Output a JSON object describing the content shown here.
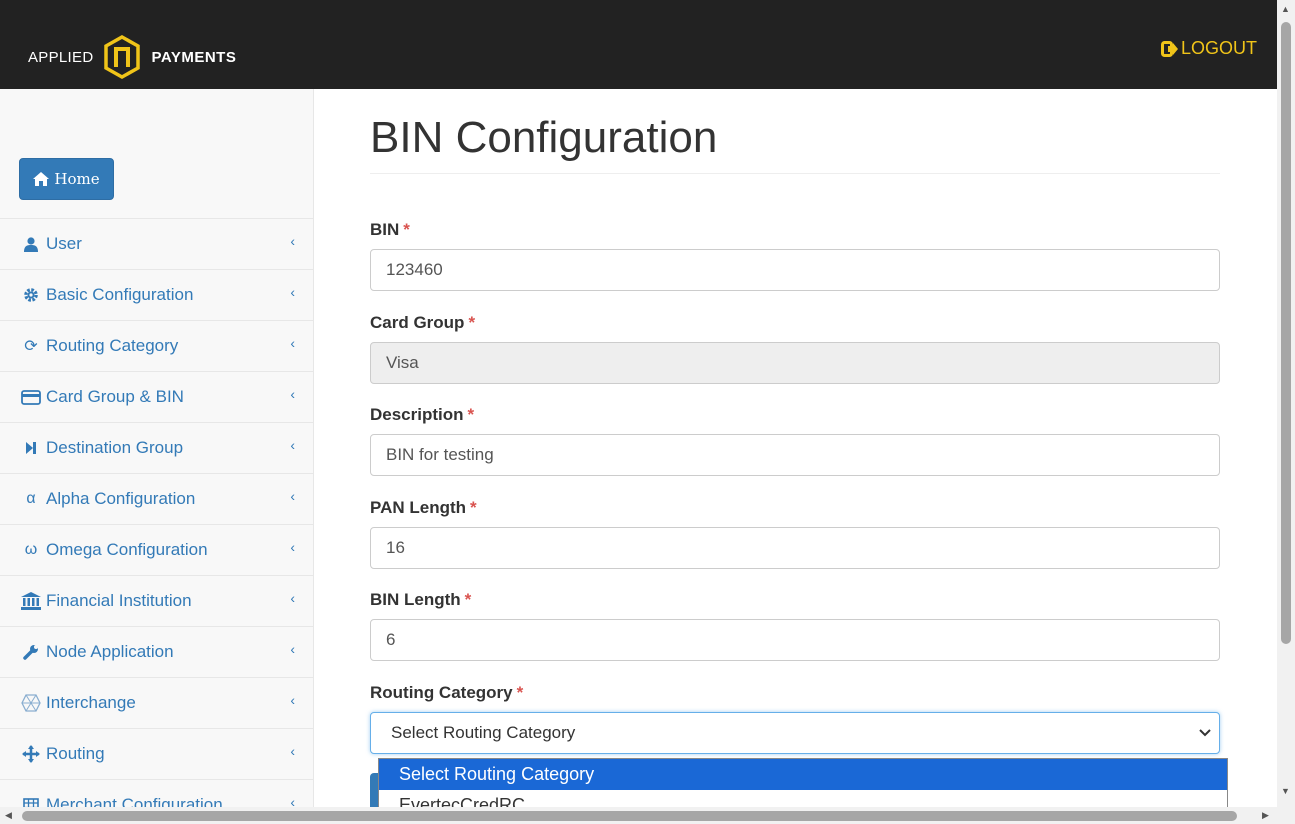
{
  "header": {
    "logo_left": "APPLIED",
    "logo_right": "PAYMENTS",
    "logout_label": "LOGOUT"
  },
  "sidebar": {
    "home_label": "Home",
    "items": [
      {
        "label": "User",
        "icon": "user-icon"
      },
      {
        "label": "Basic Configuration",
        "icon": "gear-icon"
      },
      {
        "label": "Routing Category",
        "icon": "refresh-icon"
      },
      {
        "label": "Card Group & BIN",
        "icon": "credit-card-icon"
      },
      {
        "label": "Destination Group",
        "icon": "step-forward-icon"
      },
      {
        "label": "Alpha Configuration",
        "icon": "alpha-icon"
      },
      {
        "label": "Omega Configuration",
        "icon": "omega-icon"
      },
      {
        "label": "Financial Institution",
        "icon": "bank-icon"
      },
      {
        "label": "Node Application",
        "icon": "wrench-icon"
      },
      {
        "label": "Interchange",
        "icon": "globe-icon"
      },
      {
        "label": "Routing",
        "icon": "arrows-icon"
      },
      {
        "label": "Merchant Configuration",
        "icon": "table-icon"
      }
    ]
  },
  "main": {
    "title": "BIN Configuration",
    "fields": {
      "bin": {
        "label": "BIN",
        "value": "123460"
      },
      "card_group": {
        "label": "Card Group",
        "value": "Visa"
      },
      "description": {
        "label": "Description",
        "value": "BIN for testing"
      },
      "pan_length": {
        "label": "PAN Length",
        "value": "16"
      },
      "bin_length": {
        "label": "BIN Length",
        "value": "6"
      },
      "routing_category": {
        "label": "Routing Category",
        "value": "Select Routing Category"
      }
    },
    "required_mark": "*",
    "dropdown_options": [
      "Select Routing Category",
      "EvertecCredRC"
    ]
  },
  "colors": {
    "header_bg": "#222222",
    "accent_yellow": "#f0c419",
    "link_blue": "#337ab7",
    "required_red": "#d9534f",
    "option_highlight": "#1a68d6"
  }
}
